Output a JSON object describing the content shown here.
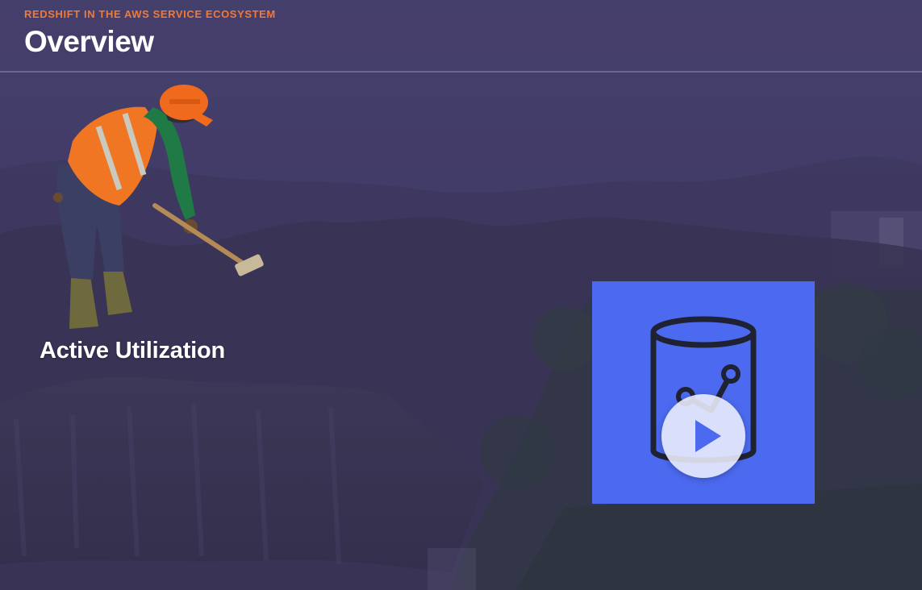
{
  "header": {
    "eyebrow": "REDSHIFT IN THE AWS SERVICE ECOSYSTEM",
    "title": "Overview"
  },
  "main": {
    "section_label": "Active Utilization",
    "illustration_icon": "construction-worker-icon",
    "video": {
      "icon": "database-analytics-icon",
      "play_icon": "play-icon"
    }
  },
  "colors": {
    "eyebrow": "#f07a34",
    "video_card": "#4b6af0",
    "play_triangle": "#4b6af0",
    "overlay": "#3d365f"
  }
}
